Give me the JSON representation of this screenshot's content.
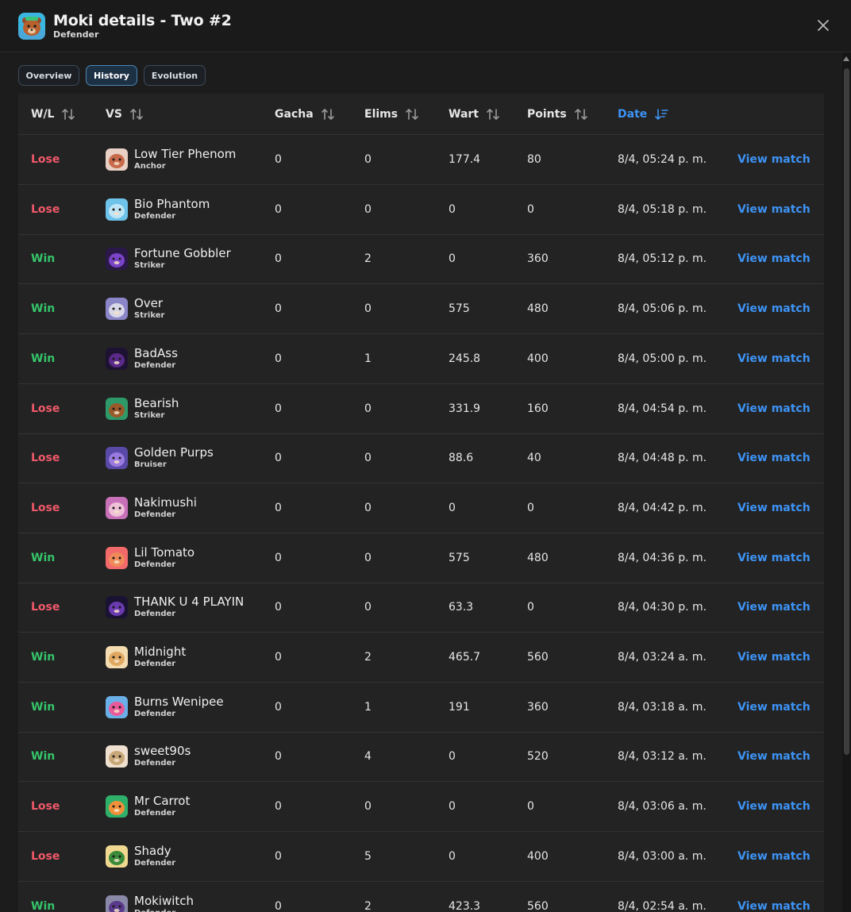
{
  "header": {
    "title": "Moki details - Two #2",
    "subtitle": "Defender",
    "avatar_icon": "moki-bear-avatar-icon"
  },
  "tabs": [
    {
      "label": "Overview",
      "active": false
    },
    {
      "label": "History",
      "active": true
    },
    {
      "label": "Evolution",
      "active": false
    }
  ],
  "columns": {
    "wl": "W/L",
    "vs": "VS",
    "gacha": "Gacha",
    "elims": "Elims",
    "wart": "Wart",
    "points": "Points",
    "date": "Date"
  },
  "colors": {
    "win": "#35c46a",
    "lose": "#f0596a",
    "link": "#3d93f5"
  },
  "rows": [
    {
      "result": "Lose",
      "name": "Low Tier Phenom",
      "role": "Anchor",
      "gacha": "0",
      "elims": "0",
      "wart": "177.4",
      "points": "80",
      "date": "8/4, 05:24 p. m.",
      "action": "View match",
      "avatar_color": "#c86a4a",
      "avatar_bg": "#e8d0c4"
    },
    {
      "result": "Lose",
      "name": "Bio Phantom",
      "role": "Defender",
      "gacha": "0",
      "elims": "0",
      "wart": "0",
      "points": "0",
      "date": "8/4, 05:18 p. m.",
      "action": "View match",
      "avatar_color": "#bfe6f7",
      "avatar_bg": "#6ec3ea"
    },
    {
      "result": "Win",
      "name": "Fortune Gobbler",
      "role": "Striker",
      "gacha": "0",
      "elims": "2",
      "wart": "0",
      "points": "360",
      "date": "8/4, 05:12 p. m.",
      "action": "View match",
      "avatar_color": "#7a44c8",
      "avatar_bg": "#2a1848"
    },
    {
      "result": "Win",
      "name": "Over",
      "role": "Striker",
      "gacha": "0",
      "elims": "0",
      "wart": "575",
      "points": "480",
      "date": "8/4, 05:06 p. m.",
      "action": "View match",
      "avatar_color": "#d8d8e8",
      "avatar_bg": "#8a86c8"
    },
    {
      "result": "Win",
      "name": "BadAss",
      "role": "Defender",
      "gacha": "0",
      "elims": "1",
      "wart": "245.8",
      "points": "400",
      "date": "8/4, 05:00 p. m.",
      "action": "View match",
      "avatar_color": "#5a2a8a",
      "avatar_bg": "#1e1232"
    },
    {
      "result": "Lose",
      "name": "Bearish",
      "role": "Striker",
      "gacha": "0",
      "elims": "0",
      "wart": "331.9",
      "points": "160",
      "date": "8/4, 04:54 p. m.",
      "action": "View match",
      "avatar_color": "#9a5a2a",
      "avatar_bg": "#2e9a6a"
    },
    {
      "result": "Lose",
      "name": "Golden Purps",
      "role": "Bruiser",
      "gacha": "0",
      "elims": "0",
      "wart": "88.6",
      "points": "40",
      "date": "8/4, 04:48 p. m.",
      "action": "View match",
      "avatar_color": "#9a7ae0",
      "avatar_bg": "#5a4aa8"
    },
    {
      "result": "Lose",
      "name": "Nakimushi",
      "role": "Defender",
      "gacha": "0",
      "elims": "0",
      "wart": "0",
      "points": "0",
      "date": "8/4, 04:42 p. m.",
      "action": "View match",
      "avatar_color": "#f0c0d8",
      "avatar_bg": "#c870b8"
    },
    {
      "result": "Win",
      "name": "Lil Tomato",
      "role": "Defender",
      "gacha": "0",
      "elims": "0",
      "wart": "575",
      "points": "480",
      "date": "8/4, 04:36 p. m.",
      "action": "View match",
      "avatar_color": "#f08a5a",
      "avatar_bg": "#f26a6a"
    },
    {
      "result": "Lose",
      "name": "THANK U 4 PLAYIN",
      "role": "Defender",
      "gacha": "0",
      "elims": "0",
      "wart": "63.3",
      "points": "0",
      "date": "8/4, 04:30 p. m.",
      "action": "View match",
      "avatar_color": "#6a3ab0",
      "avatar_bg": "#1a1232"
    },
    {
      "result": "Win",
      "name": "Midnight",
      "role": "Defender",
      "gacha": "0",
      "elims": "2",
      "wart": "465.7",
      "points": "560",
      "date": "8/4, 03:24 a. m.",
      "action": "View match",
      "avatar_color": "#e0a860",
      "avatar_bg": "#f4dcb0"
    },
    {
      "result": "Win",
      "name": "Burns Wenipee",
      "role": "Defender",
      "gacha": "0",
      "elims": "1",
      "wart": "191",
      "points": "360",
      "date": "8/4, 03:18 a. m.",
      "action": "View match",
      "avatar_color": "#e85a9a",
      "avatar_bg": "#6ab0e8"
    },
    {
      "result": "Win",
      "name": "sweet90s",
      "role": "Defender",
      "gacha": "0",
      "elims": "4",
      "wart": "0",
      "points": "520",
      "date": "8/4, 03:12 a. m.",
      "action": "View match",
      "avatar_color": "#c8a878",
      "avatar_bg": "#f0e0d0"
    },
    {
      "result": "Lose",
      "name": "Mr Carrot",
      "role": "Defender",
      "gacha": "0",
      "elims": "0",
      "wart": "0",
      "points": "0",
      "date": "8/4, 03:06 a. m.",
      "action": "View match",
      "avatar_color": "#f0903a",
      "avatar_bg": "#2eb06a"
    },
    {
      "result": "Lose",
      "name": "Shady",
      "role": "Defender",
      "gacha": "0",
      "elims": "5",
      "wart": "0",
      "points": "400",
      "date": "8/4, 03:00 a. m.",
      "action": "View match",
      "avatar_color": "#3a8a3a",
      "avatar_bg": "#f0d890"
    },
    {
      "result": "Win",
      "name": "Mokiwitch",
      "role": "Defender",
      "gacha": "0",
      "elims": "2",
      "wart": "423.3",
      "points": "560",
      "date": "8/4, 02:54 a. m.",
      "action": "View match",
      "avatar_color": "#5a3a8a",
      "avatar_bg": "#8a8aa8"
    }
  ]
}
